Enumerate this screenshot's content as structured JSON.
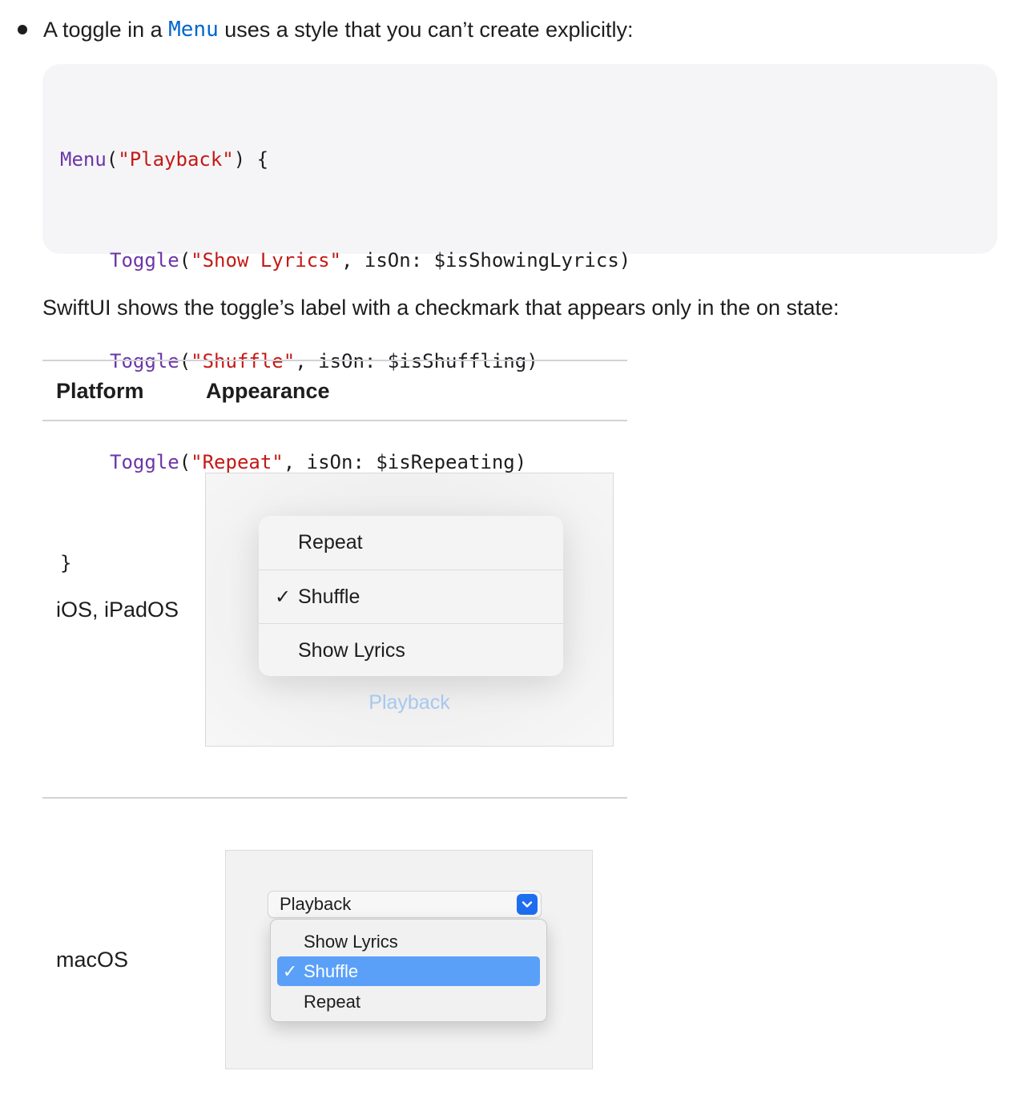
{
  "intro": {
    "prefix": "A toggle in a ",
    "link": "Menu",
    "suffix": " uses a style that you can’t create explicitly:"
  },
  "code": {
    "line1": {
      "type": "Menu",
      "open": "(",
      "str": "\"Playback\"",
      "close": ") {"
    },
    "line2": {
      "type": "Toggle",
      "open": "(",
      "str": "\"Show Lyrics\"",
      "rest": ", isOn: $isShowingLyrics)"
    },
    "line3": {
      "type": "Toggle",
      "open": "(",
      "str": "\"Shuffle\"",
      "rest": ", isOn: $isShuffling)"
    },
    "line4": {
      "type": "Toggle",
      "open": "(",
      "str": "\"Repeat\"",
      "rest": ", isOn: $isRepeating)"
    },
    "line5": "}"
  },
  "description": "SwiftUI shows the toggle’s label with a checkmark that appears only in the on state:",
  "table": {
    "headers": [
      "Platform",
      "Appearance"
    ],
    "rows": [
      {
        "platform": "iOS, iPadOS"
      },
      {
        "platform": "macOS"
      }
    ]
  },
  "ios_menu": {
    "items": [
      {
        "label": "Repeat",
        "checked": false
      },
      {
        "label": "Shuffle",
        "checked": true
      },
      {
        "label": "Show Lyrics",
        "checked": false
      }
    ],
    "title": "Playback",
    "check_glyph": "✓"
  },
  "mac_menu": {
    "popup_label": "Playback",
    "items": [
      {
        "label": "Show Lyrics",
        "checked": false
      },
      {
        "label": "Shuffle",
        "checked": true
      },
      {
        "label": "Repeat",
        "checked": false
      }
    ],
    "check_glyph": "✓"
  },
  "colors": {
    "link": "#0066cc",
    "code_keyword": "#6c36a9",
    "code_string": "#c41a16",
    "mac_selection": "#5aa0f8",
    "ios_title": "#a7c8ef"
  }
}
